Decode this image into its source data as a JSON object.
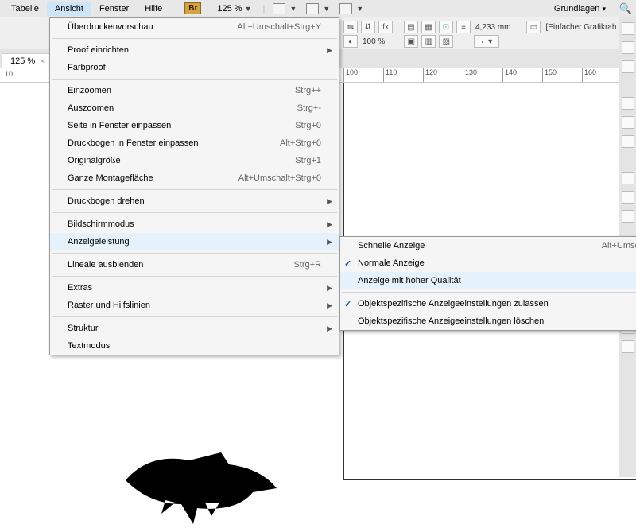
{
  "menubar": {
    "items": [
      "Tabelle",
      "Ansicht",
      "Fenster",
      "Hilfe"
    ],
    "br": "Br",
    "zoom": "125 %",
    "right_label": "Grundlagen"
  },
  "tab": {
    "label": "125 %"
  },
  "ruler": {
    "start": "10",
    "ticks": [
      "100",
      "110",
      "120",
      "130",
      "140",
      "150",
      "160"
    ]
  },
  "toolbar2": {
    "fx": "fx",
    "mm": "4,233 mm",
    "pct": "100 %",
    "frame": "[Einfacher Grafikrah"
  },
  "menu": {
    "items": [
      {
        "label": "Überdruckenvorschau",
        "shortcut": "Alt+Umschalt+Strg+Y"
      },
      {
        "sep": true
      },
      {
        "label": "Proof einrichten",
        "sub": true
      },
      {
        "label": "Farbproof"
      },
      {
        "sep": true
      },
      {
        "label": "Einzoomen",
        "shortcut": "Strg++"
      },
      {
        "label": "Auszoomen",
        "shortcut": "Strg+-"
      },
      {
        "label": "Seite in Fenster einpassen",
        "shortcut": "Strg+0"
      },
      {
        "label": "Druckbogen in Fenster einpassen",
        "shortcut": "Alt+Strg+0"
      },
      {
        "label": "Originalgröße",
        "shortcut": "Strg+1"
      },
      {
        "label": "Ganze Montagefläche",
        "shortcut": "Alt+Umschalt+Strg+0"
      },
      {
        "sep": true
      },
      {
        "label": "Druckbogen drehen",
        "sub": true
      },
      {
        "sep": true
      },
      {
        "label": "Bildschirmmodus",
        "sub": true
      },
      {
        "label": "Anzeigeleistung",
        "sub": true,
        "hl": true
      },
      {
        "sep": true
      },
      {
        "label": "Lineale ausblenden",
        "shortcut": "Strg+R"
      },
      {
        "sep": true
      },
      {
        "label": "Extras",
        "sub": true
      },
      {
        "label": "Raster und Hilfslinien",
        "sub": true
      },
      {
        "sep": true
      },
      {
        "label": "Struktur",
        "sub": true
      },
      {
        "label": "Textmodus"
      }
    ]
  },
  "submenu": {
    "items": [
      {
        "label": "Schnelle Anzeige",
        "shortcut": "Alt+Umsc"
      },
      {
        "label": "Normale Anzeige",
        "check": true
      },
      {
        "label": "Anzeige mit hoher Qualität",
        "hl": true
      },
      {
        "sep": true
      },
      {
        "label": "Objektspezifische Anzeigeeinstellungen zulassen",
        "check": true
      },
      {
        "label": "Objektspezifische Anzeigeeinstellungen löschen"
      }
    ]
  }
}
